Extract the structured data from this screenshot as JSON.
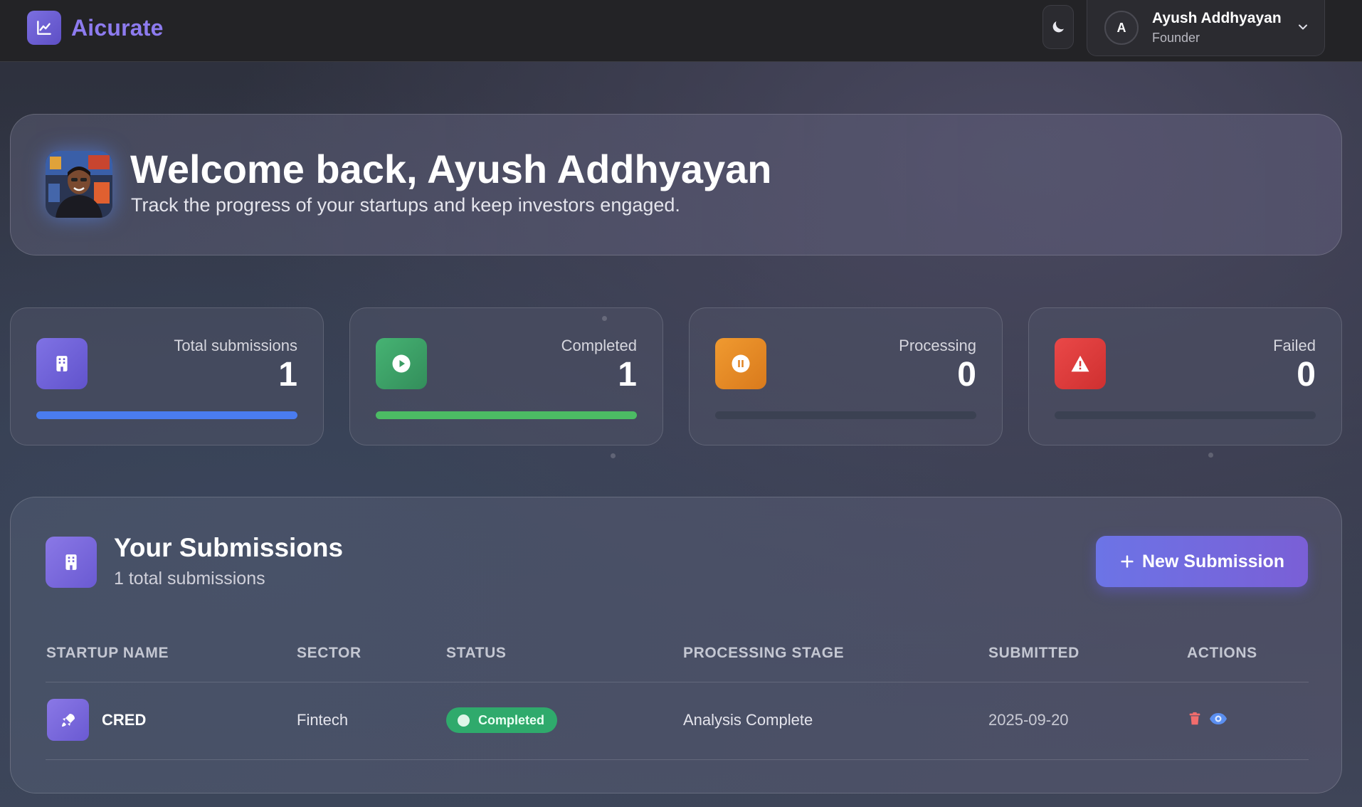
{
  "app": {
    "name": "Aicurate"
  },
  "header": {
    "user": {
      "initial": "A",
      "name": "Ayush Addhyayan",
      "role": "Founder"
    }
  },
  "welcome": {
    "title": "Welcome back, Ayush Addhyayan",
    "subtitle": "Track the progress of your startups and keep investors engaged."
  },
  "stats": [
    {
      "label": "Total submissions",
      "value": "1",
      "icon": "building-icon",
      "color": "#7163d8",
      "progress": 1.0,
      "bar_color": "#4a7cf0"
    },
    {
      "label": "Completed",
      "value": "1",
      "icon": "play-circle-icon",
      "color": "#3fa569",
      "progress": 1.0,
      "bar_color": "#4cbb64"
    },
    {
      "label": "Processing",
      "value": "0",
      "icon": "pause-circle-icon",
      "color": "#e58a25",
      "progress": 0.0,
      "bar_color": "#e58a25"
    },
    {
      "label": "Failed",
      "value": "0",
      "icon": "warning-icon",
      "color": "#e03c3c",
      "progress": 0.0,
      "bar_color": "#e03c3c"
    }
  ],
  "submissions": {
    "title": "Your Submissions",
    "count_text": "1 total submissions",
    "new_button": "New Submission",
    "columns": [
      "STARTUP NAME",
      "SECTOR",
      "STATUS",
      "PROCESSING STAGE",
      "SUBMITTED",
      "ACTIONS"
    ],
    "rows": [
      {
        "name": "CRED",
        "sector": "Fintech",
        "status": "Completed",
        "stage": "Analysis Complete",
        "submitted": "2025-09-20"
      }
    ]
  }
}
